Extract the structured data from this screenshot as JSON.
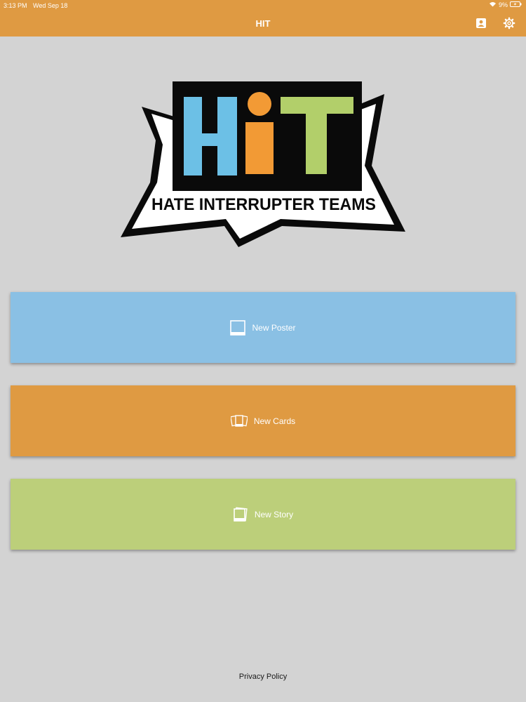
{
  "status_bar": {
    "time": "3:13 PM",
    "date": "Wed Sep 18",
    "battery": "9%"
  },
  "header": {
    "title": "HIT",
    "profile_icon": "person-card-icon",
    "settings_icon": "gear-icon"
  },
  "logo": {
    "letters": [
      "H",
      "i",
      "T"
    ],
    "tagline": "HATE INTERRUPTER TEAMS",
    "colors": {
      "h": "#6cc0e6",
      "i": "#f29a35",
      "t": "#b2cf6a"
    }
  },
  "actions": {
    "poster": {
      "label": "New Poster",
      "icon": "poster-icon",
      "color": "#8ac0e4"
    },
    "cards": {
      "label": "New Cards",
      "icon": "cards-icon",
      "color": "#df9a42"
    },
    "story": {
      "label": "New Story",
      "icon": "story-icon",
      "color": "#bccf7a"
    }
  },
  "footer": {
    "privacy_label": "Privacy Policy"
  },
  "colors": {
    "accent": "#df9a42",
    "background": "#d3d3d3"
  }
}
